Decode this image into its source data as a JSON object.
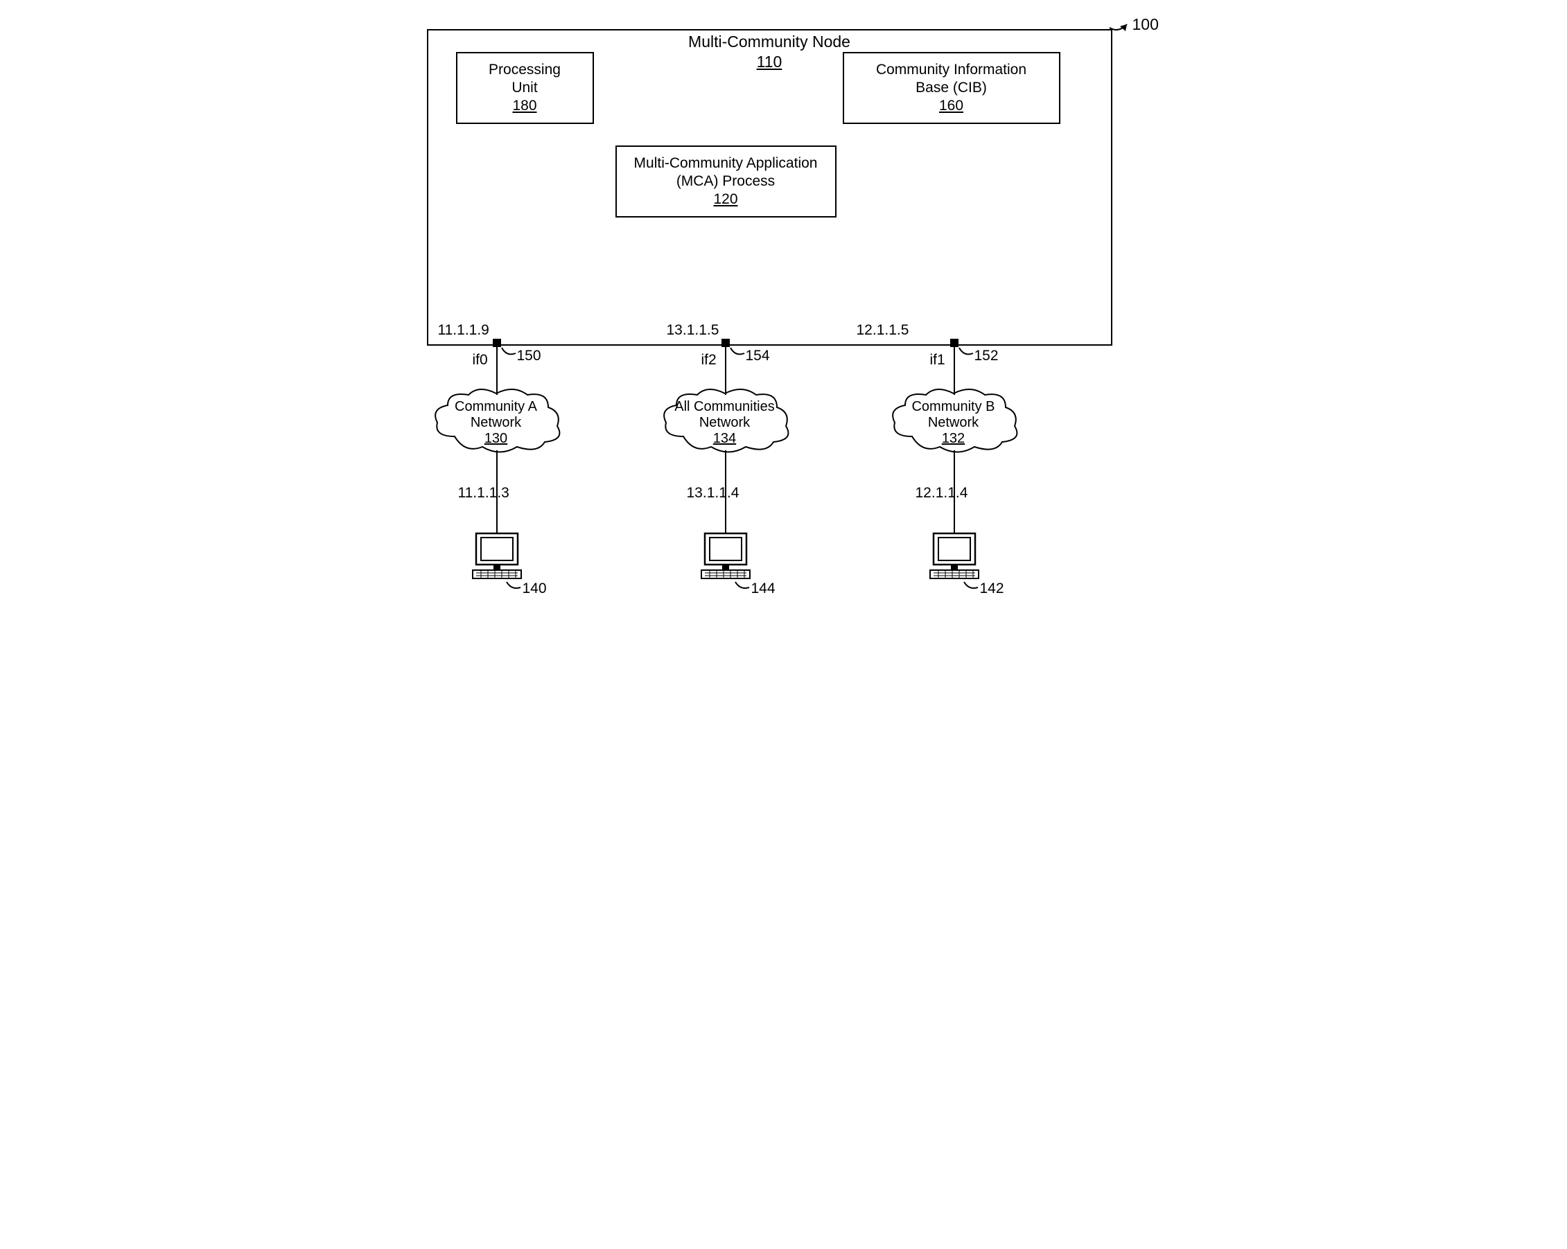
{
  "figure_ref": "100",
  "node": {
    "title": "Multi-Community Node",
    "ref": "110",
    "processing_unit": {
      "label1": "Processing",
      "label2": "Unit",
      "ref": "180"
    },
    "cib": {
      "label1": "Community Information",
      "label2": "Base (CIB)",
      "ref": "160"
    },
    "mca": {
      "label1": "Multi-Community Application",
      "label2": "(MCA) Process",
      "ref": "120"
    }
  },
  "interfaces": [
    {
      "ip": "11.1.1.9",
      "name": "if0",
      "ref": "150"
    },
    {
      "ip": "13.1.1.5",
      "name": "if2",
      "ref": "154"
    },
    {
      "ip": "12.1.1.5",
      "name": "if1",
      "ref": "152"
    }
  ],
  "clouds": [
    {
      "line1": "Community A",
      "line2": "Network",
      "ref": "130"
    },
    {
      "line1": "All Communities",
      "line2": "Network",
      "ref": "134"
    },
    {
      "line1": "Community B",
      "line2": "Network",
      "ref": "132"
    }
  ],
  "endpoints": [
    {
      "ip": "11.1.1.3",
      "ref": "140"
    },
    {
      "ip": "13.1.1.4",
      "ref": "144"
    },
    {
      "ip": "12.1.1.4",
      "ref": "142"
    }
  ]
}
